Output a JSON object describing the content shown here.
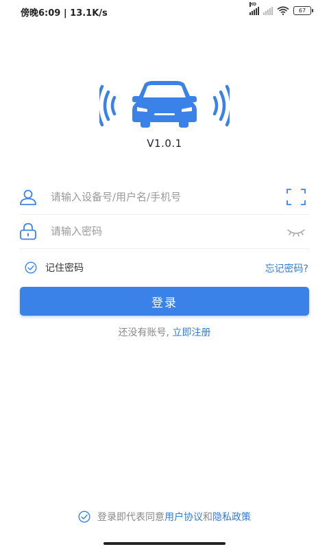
{
  "status_bar": {
    "time": "傍晚6:09",
    "net_speed": "13.1K/s",
    "signal_label": "HD",
    "battery": "67"
  },
  "app": {
    "logo_icon": "car-signal-icon",
    "version": "V1.0.1",
    "brand_color": "#3a82e8"
  },
  "form": {
    "username_placeholder": "请输入设备号/用户名/手机号",
    "password_placeholder": "请输入密码",
    "remember_label": "记住密码",
    "forgot_label": "忘记密码?",
    "login_label": "登录"
  },
  "register": {
    "prompt": "还没有账号, ",
    "link": "立即注册"
  },
  "agreement": {
    "prefix": "登录即代表同意",
    "user_agreement": "用户协议",
    "and": "和",
    "privacy_policy": "隐私政策"
  }
}
